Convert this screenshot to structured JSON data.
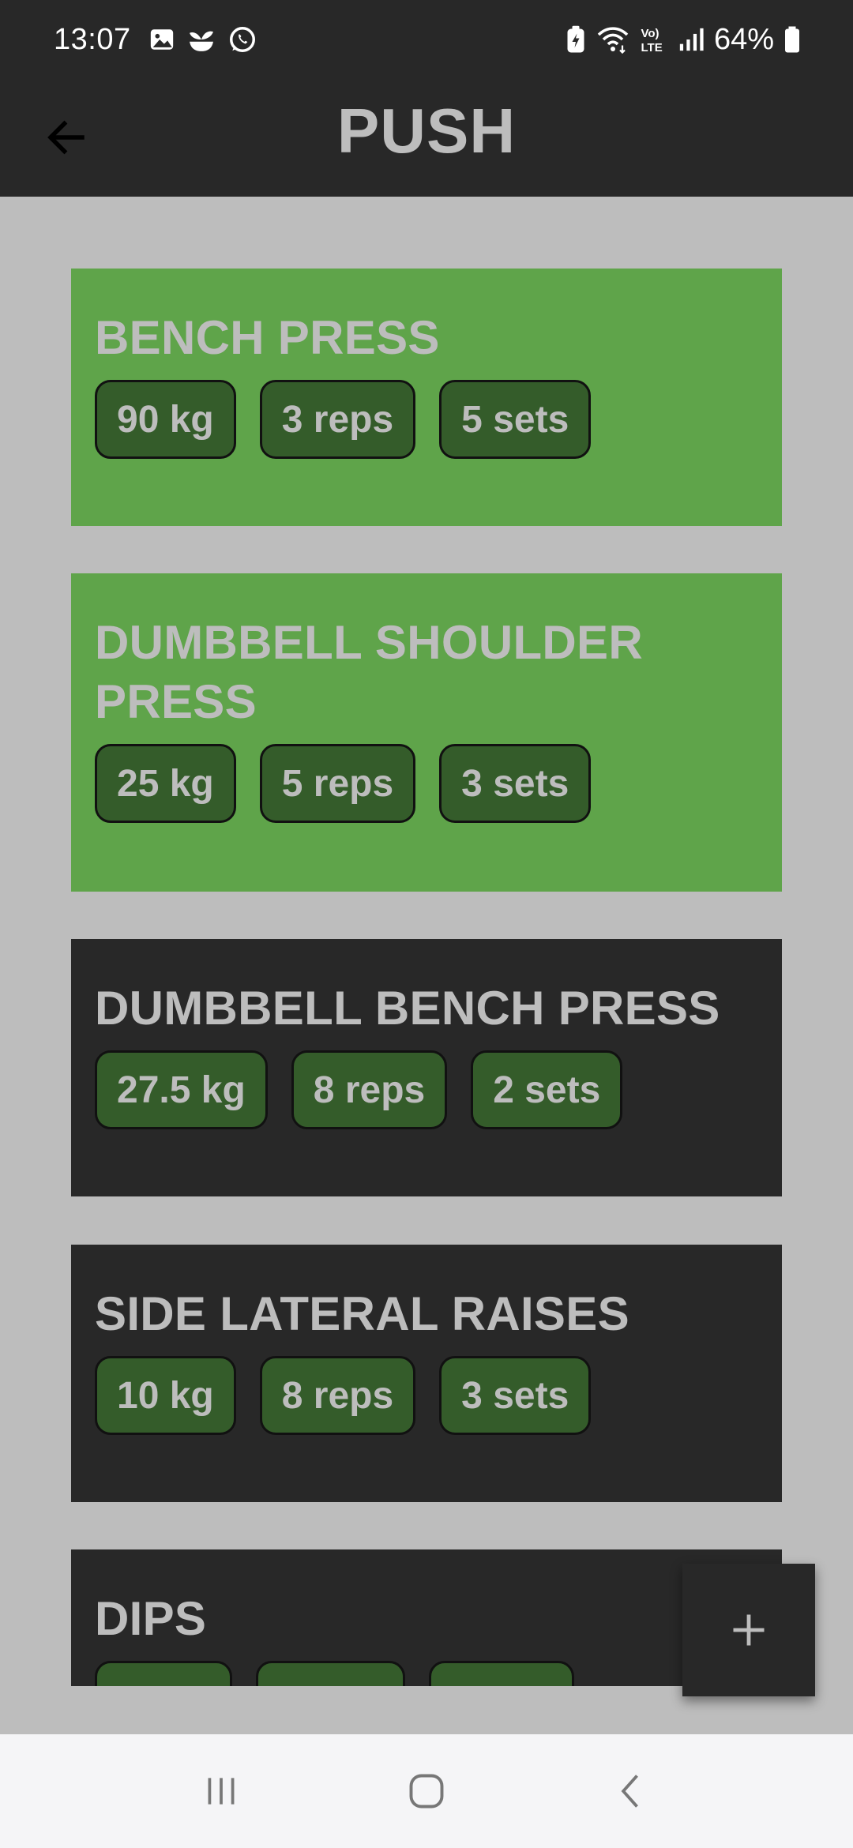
{
  "status_bar": {
    "time": "13:07",
    "battery": "64%",
    "left_icons": [
      "gallery-icon",
      "plant-icon",
      "whatsapp-icon"
    ],
    "right_icons": [
      "battery-saver-icon",
      "wifi-icon",
      "volte-icon",
      "signal-icon",
      "battery-icon"
    ],
    "volte_label": "Vo)\nLTE"
  },
  "header": {
    "title": "PUSH",
    "back_icon": "arrow-left-icon"
  },
  "exercises": [
    {
      "name": "BENCH PRESS",
      "weight": "90 kg",
      "reps": "3 reps",
      "sets": "5 sets",
      "completed": true
    },
    {
      "name": "DUMBBELL SHOULDER PRESS",
      "weight": "25 kg",
      "reps": "5 reps",
      "sets": "3 sets",
      "completed": true
    },
    {
      "name": "DUMBBELL BENCH PRESS",
      "weight": "27.5 kg",
      "reps": "8 reps",
      "sets": "2 sets",
      "completed": false
    },
    {
      "name": "SIDE LATERAL RAISES",
      "weight": "10 kg",
      "reps": "8 reps",
      "sets": "3 sets",
      "completed": false
    },
    {
      "name": "DIPS",
      "weight": "",
      "reps": "",
      "sets": "",
      "completed": false
    }
  ],
  "fab": {
    "icon": "plus-icon"
  },
  "colors": {
    "bar_background": "#282828",
    "page_background": "#bdbdbd",
    "completed_card": "#5fa44a",
    "pending_card": "#282828",
    "chip_background": "#345c2a",
    "text": "#bdbdbd"
  },
  "nav_bar": {
    "icons": [
      "recent-apps-icon",
      "home-icon",
      "back-icon"
    ]
  }
}
